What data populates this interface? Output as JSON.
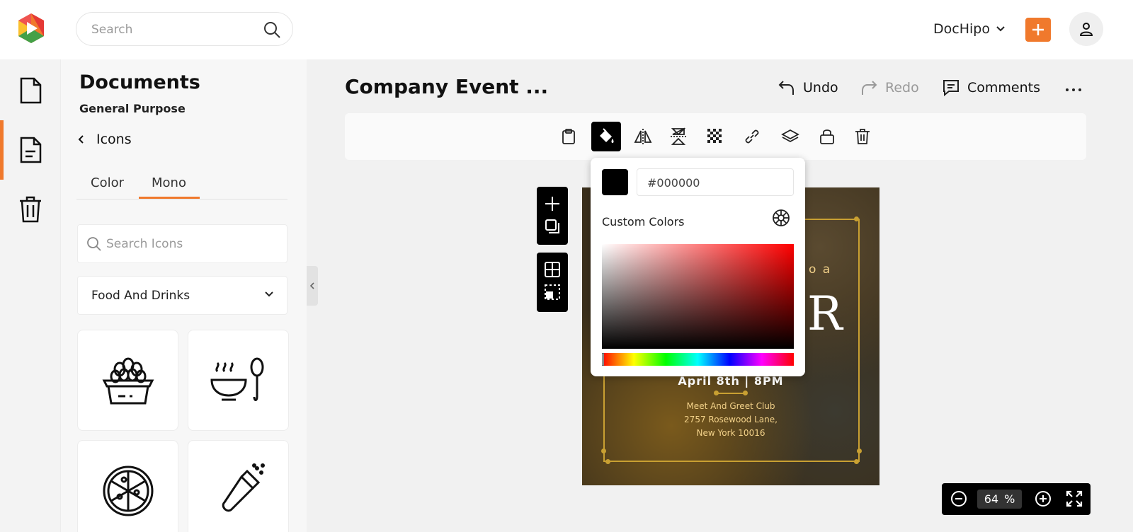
{
  "header": {
    "search_placeholder": "Search",
    "brand": "DocHipo"
  },
  "sidebar": {
    "items": [
      {
        "name": "documents",
        "icon": "file-icon"
      },
      {
        "name": "templates",
        "icon": "document-text-icon",
        "active": true
      },
      {
        "name": "trash",
        "icon": "trash-icon"
      }
    ]
  },
  "panel": {
    "title": "Documents",
    "subtitle": "General Purpose",
    "back_label": "Icons",
    "tabs": [
      "Color",
      "Mono"
    ],
    "active_tab": "Mono",
    "search_placeholder": "Search Icons",
    "category": "Food And Drinks",
    "tiles": [
      "egg-basket-icon",
      "soup-bowl-spoon-icon",
      "pizza-icon",
      "salt-shaker-icon"
    ]
  },
  "editor": {
    "doc_title": "Company Event ...",
    "undo_label": "Undo",
    "redo_label": "Redo",
    "comments_label": "Comments",
    "toolbar_tools": [
      "clipboard-icon",
      "paint-bucket-icon",
      "flip-horizontal-icon",
      "flip-vertical-icon",
      "transparency-icon",
      "link-icon",
      "layers-icon",
      "lock-icon",
      "trash-icon"
    ],
    "active_tool": "paint-bucket-icon"
  },
  "color_picker": {
    "current_hex": "#000000",
    "custom_colors_label": "Custom Colors"
  },
  "canvas": {
    "line_partial_top": "o a",
    "line_partial_big": "R",
    "date_line": "April 8th | 8PM",
    "venue_line1": "Meet And Greet Club",
    "venue_line2": "2757 Rosewood Lane,",
    "venue_line3": "New York 10016"
  },
  "zoom": {
    "value": "64",
    "unit": "%"
  },
  "colors": {
    "accent": "#f0792c",
    "gold": "#c9a032",
    "toolbar_active": "#000000"
  }
}
